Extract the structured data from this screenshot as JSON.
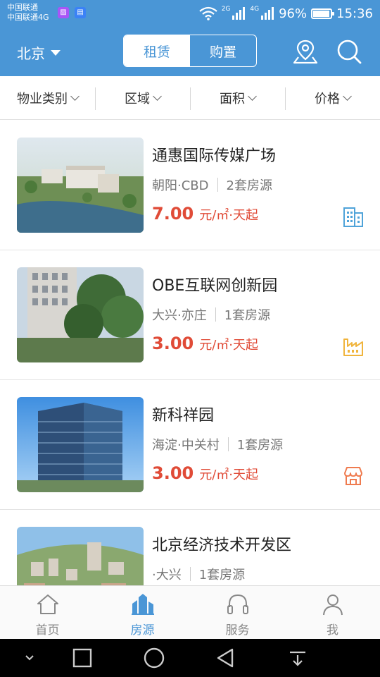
{
  "status_bar": {
    "carrier_1": "中国联通",
    "carrier_2": "中国联通4G",
    "app_icons": [
      {
        "name": "gallery-notification-icon",
        "color": "#a855f7"
      },
      {
        "name": "app-notification-icon",
        "color": "#3b82f6"
      }
    ],
    "net_1": "2G",
    "net_2": "4G",
    "battery_percent": "96%",
    "battery_level": 0.96,
    "time": "15:36"
  },
  "header": {
    "city": "北京",
    "tabs": [
      "租赁",
      "购置"
    ],
    "active_tab": 0,
    "accent": "#4a96d6"
  },
  "filters": [
    "物业类别",
    "区域",
    "面积",
    "价格"
  ],
  "listings": [
    {
      "name": "通惠国际传媒广场",
      "location": "朝阳·CBD",
      "count": "2套房源",
      "price": "7.00",
      "unit": "元/㎡·天起",
      "type_icon": "office-building-icon",
      "icon_color": "#4fa3d9"
    },
    {
      "name": "OBE互联网创新园",
      "location": "大兴·亦庄",
      "count": "1套房源",
      "price": "3.00",
      "unit": "元/㎡·天起",
      "type_icon": "factory-icon",
      "icon_color": "#f0b43c"
    },
    {
      "name": "新科祥园",
      "location": "海淀·中关村",
      "count": "1套房源",
      "price": "3.00",
      "unit": "元/㎡·天起",
      "type_icon": "shop-icon",
      "icon_color": "#ef7b4f"
    },
    {
      "name": "北京经济技术开发区",
      "location": "·大兴",
      "count": "1套房源",
      "price": "",
      "unit": "",
      "type_icon": "",
      "icon_color": ""
    }
  ],
  "price_color": "#e04b37",
  "tabbar": [
    {
      "label": "首页",
      "icon": "home-icon"
    },
    {
      "label": "房源",
      "icon": "buildings-icon"
    },
    {
      "label": "服务",
      "icon": "headphones-icon"
    },
    {
      "label": "我",
      "icon": "user-icon"
    }
  ],
  "active_tabbar": 1
}
